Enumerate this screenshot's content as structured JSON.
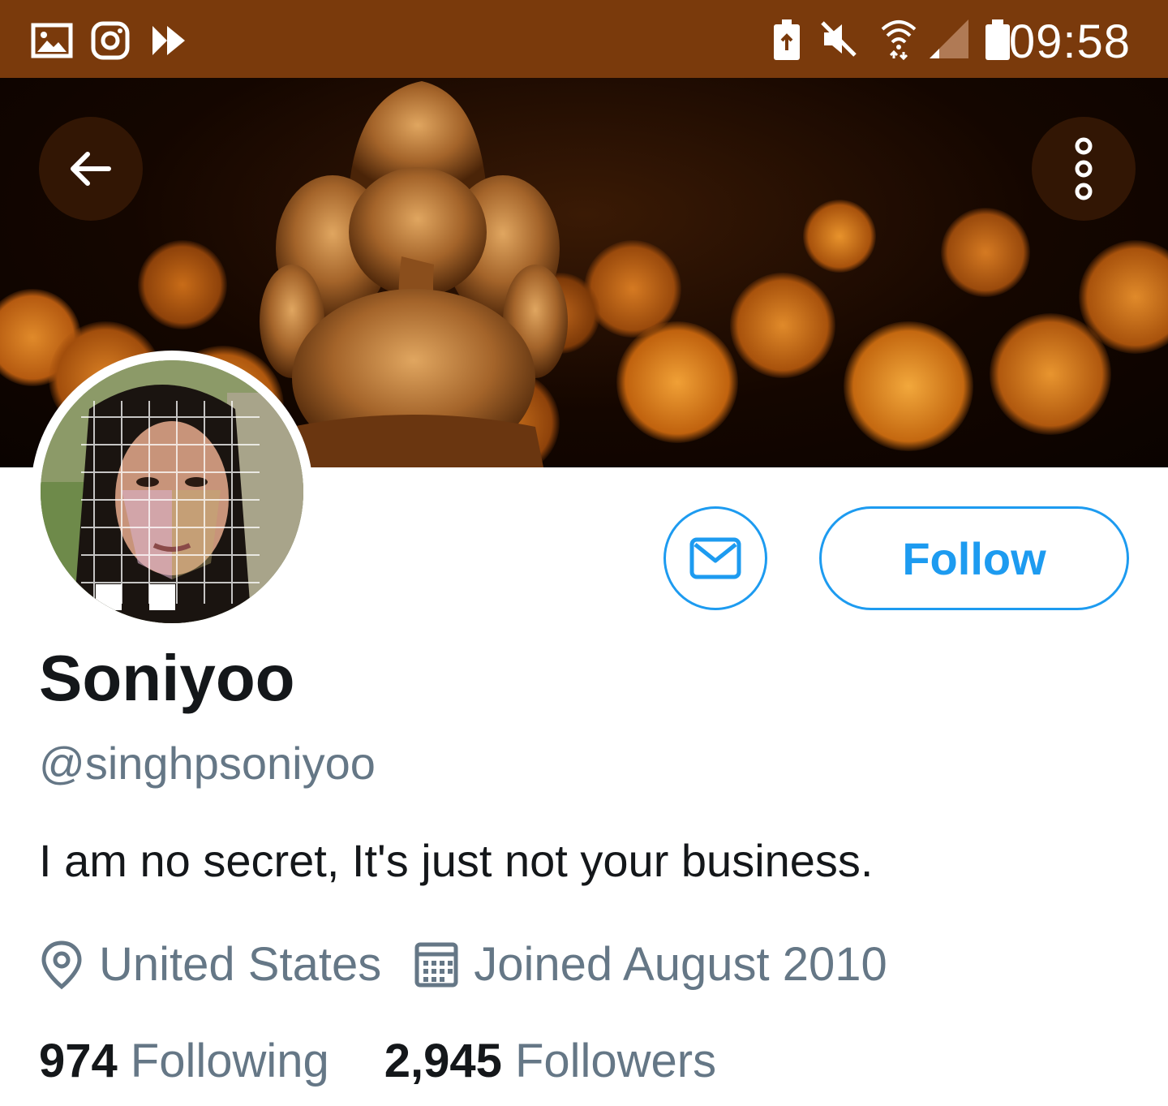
{
  "status_bar": {
    "time": "09:58",
    "left_icons": [
      "gallery-icon",
      "instagram-icon",
      "play-store-icon"
    ],
    "right_icons": [
      "battery-saver-icon",
      "mute-icon",
      "wifi-icon",
      "signal-icon",
      "battery-icon"
    ],
    "background": "#7a3a0c"
  },
  "header": {
    "back_icon": "back-arrow-icon",
    "more_icon": "more-vertical-icon"
  },
  "profile": {
    "display_name": "Soniyoo",
    "handle": "@singhpsoniyoo",
    "bio": "I am no secret, It's just not your business.",
    "location": "United States",
    "joined": "Joined August 2010",
    "following_count": "974",
    "following_label": "Following",
    "followers_count": "2,945",
    "followers_label": "Followers"
  },
  "actions": {
    "follow_label": "Follow",
    "message_icon": "envelope-icon"
  },
  "colors": {
    "accent": "#1d9bf0",
    "text_primary": "#14171a",
    "text_secondary": "#657786"
  }
}
